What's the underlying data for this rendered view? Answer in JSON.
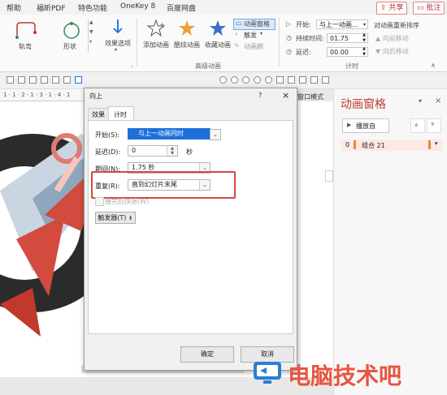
{
  "menubar": {
    "items": [
      "帮助",
      "福昕PDF",
      "特色功能",
      "OneKey 8",
      "百度网盘"
    ],
    "share_label": "共享",
    "comment_label": "批注"
  },
  "ribbon": {
    "effects": [
      "轨弯",
      "形状"
    ],
    "effect_options_label": "效果选项",
    "add_animation_label": "添加动画",
    "painter_label": "酷炫动画",
    "favorite_label": "收藏动画",
    "anim_pane_label": "动画窗格",
    "trigger_label": "触发",
    "anim_brush_label": "动画刷",
    "advanced_group_label": "高级动画",
    "start_label": "开始:",
    "start_value": "与上一动画...",
    "duration_label": "持续时间:",
    "duration_value": "01.75",
    "delay_label": "延迟:",
    "delay_value": "00.00",
    "reorder_label": "对动画重新排序",
    "move_earlier_label": "向前移动",
    "move_later_label": "向后移动",
    "timing_group_label": "计时"
  },
  "ruler": {
    "text": "1 · 1 · 2 · 1 · 3 · 1 · 4 · 1"
  },
  "window_mode_label": "窗口模式",
  "anim_pane": {
    "title": "动画窗格",
    "play_label": "播放自",
    "item_index": "0",
    "item_label": "组合 21"
  },
  "dialog": {
    "title": "向上",
    "help": "?",
    "tabs": [
      "效果",
      "计时"
    ],
    "start_label": "开始(S):",
    "start_value": "与上一动画同时",
    "delay_label": "延迟(D):",
    "delay_value": "0",
    "delay_unit": "秒",
    "duration_label": "期间(N):",
    "duration_value": "1.75 秒",
    "repeat_label": "重复(R):",
    "repeat_value": "直到幻灯片末尾",
    "rewind_label": "播完后快退(W)",
    "trigger_label": "触发器(T)",
    "ok_label": "确定",
    "cancel_label": "取消"
  },
  "watermark": {
    "text": "电脑技术吧"
  },
  "colors": {
    "accent_red": "#c0392b",
    "selection_blue": "#1e6fd9",
    "highlight_border": "#d24b3e",
    "dialog_bg": "#f0f0f0"
  }
}
